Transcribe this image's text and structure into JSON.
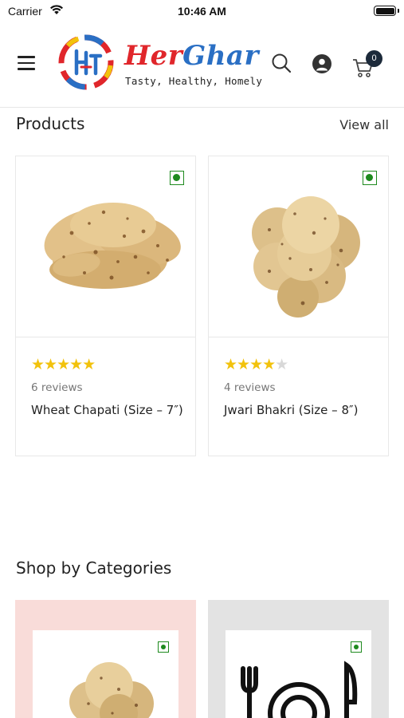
{
  "status_bar": {
    "carrier": "Carrier",
    "time": "10:46 AM"
  },
  "header": {
    "brand_first": "Her",
    "brand_second": "Ghar",
    "tagline": "Tasty, Healthy, Homely",
    "cart_count": "0",
    "icons": [
      "menu-icon",
      "logo-icon",
      "search-icon",
      "user-icon",
      "cart-icon"
    ]
  },
  "products": {
    "title": "Products",
    "view_all": "View all",
    "items": [
      {
        "name": "Wheat Chapati (Size – 7″)",
        "reviews": "6 reviews",
        "rating": 5,
        "rating_max": 5
      },
      {
        "name": "Jwari Bhakri (Size – 8″)",
        "reviews": "4 reviews",
        "rating": 4,
        "rating_max": 5
      }
    ]
  },
  "categories": {
    "title": "Shop by Categories"
  },
  "colors": {
    "brand_red": "#e0262b",
    "brand_blue": "#2a6fc4",
    "star": "#f2c20c",
    "veg_green": "#1e8a1e",
    "cat_pink": "#f9dcd9",
    "cat_grey": "#e3e3e3"
  }
}
